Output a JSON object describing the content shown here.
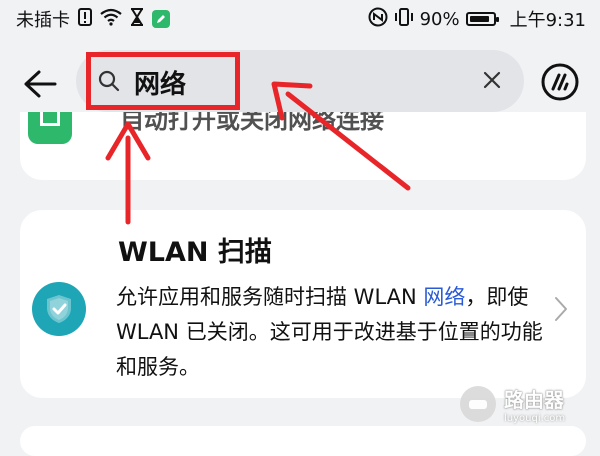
{
  "status_bar": {
    "carrier": "未插卡",
    "battery_percent": "90%",
    "battery_level": 0.9,
    "time": "上午9:31"
  },
  "search": {
    "query": "网络"
  },
  "top_card": {
    "text": "自动打开或关闭网络连接"
  },
  "wlan_card": {
    "title": "WLAN 扫描",
    "desc_part1": "允许应用和服务随时扫描 WLAN ",
    "desc_keyword": "网络",
    "desc_part2": "，即使 WLAN 已关闭。这可用于改进基于位置的功能和服务。"
  },
  "watermark": {
    "title": "路由器",
    "subtitle": "luyouqi.com"
  },
  "colors": {
    "annotation": "#e8262a",
    "keyword": "#2a5bd7",
    "shield": "#1ea5b6",
    "app_green": "#2db86b"
  }
}
